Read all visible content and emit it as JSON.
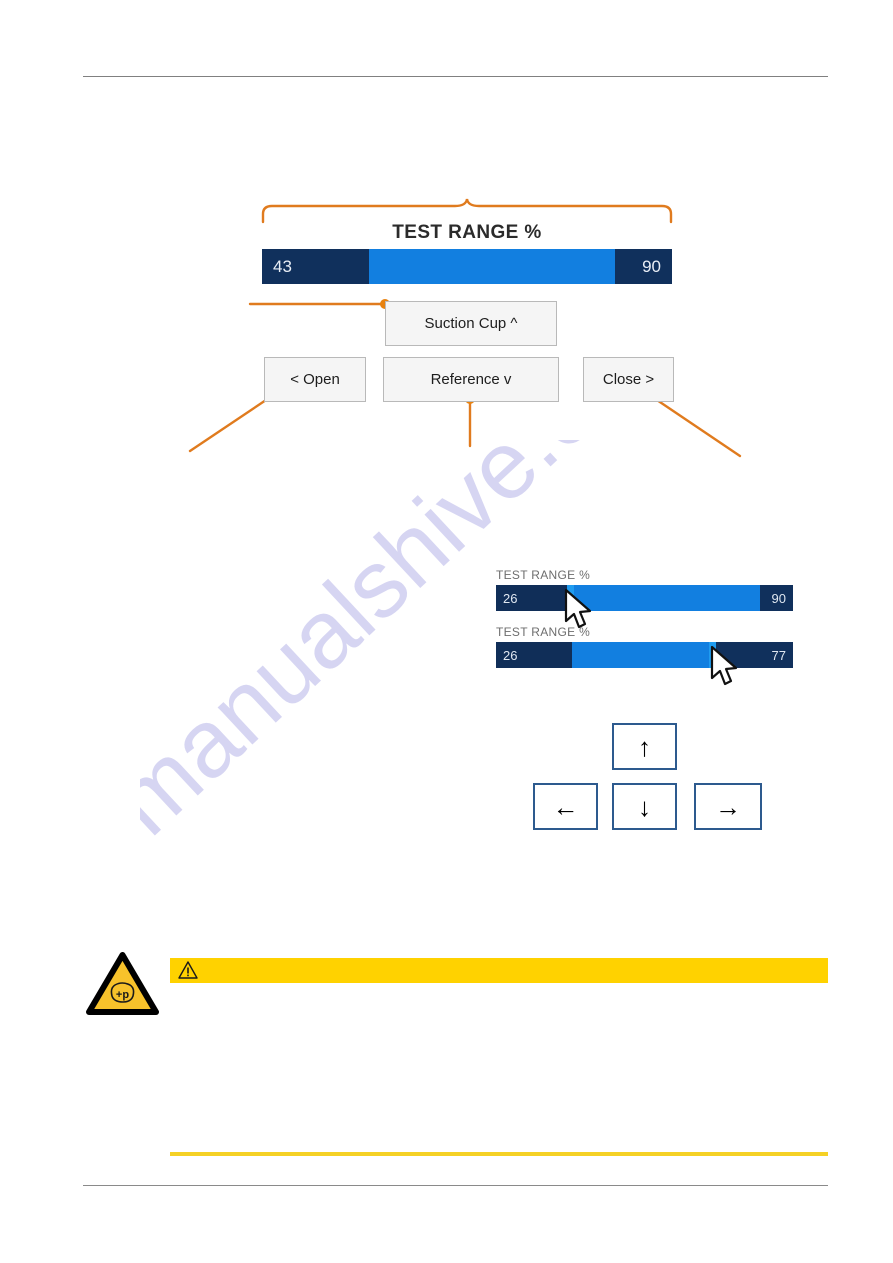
{
  "page": {
    "watermark_text": "manualshive.com",
    "colors": {
      "accent_orange": "#e07b1e",
      "bar_dark_navy": "#10305c",
      "bar_blue": "#127fe0",
      "bar_handle_blue": "#1f9cf0",
      "warning_yellow": "#ffd200",
      "rule_yellow": "#f5d125",
      "rule_gray": "#808080",
      "key_border_blue": "#2d5a8e"
    }
  },
  "main_slider": {
    "caption": "TEST RANGE %",
    "min_value": "43",
    "max_value": "90",
    "min_pct": 26,
    "max_pct": 88
  },
  "buttons": {
    "suction_cup": "Suction Cup ^",
    "open": "< Open",
    "reference": "Reference v",
    "close": "Close >"
  },
  "mini_sliders": [
    {
      "label": "TEST RANGE %",
      "min_value": "26",
      "max_value": "90",
      "min_pct": 24,
      "max_pct": 89,
      "cursor": "arrow-cursor-left-handle"
    },
    {
      "label": "TEST RANGE %",
      "min_value": "26",
      "max_value": "77",
      "min_pct": 24,
      "max_pct": 74,
      "cursor": "arrow-cursor-right-handle"
    }
  ],
  "arrow_keys": {
    "up": "↑",
    "left": "←",
    "down": "↓",
    "right": "→"
  },
  "warning": {
    "banner_text": "",
    "banner_icon": "warning-triangle-icon",
    "hazard_icon": "pressure-hazard-icon",
    "hazard_icon_label": "+p"
  },
  "annotations": {
    "brace": "curly-brace-over-test-range",
    "leaders": [
      "leader-suction-cup",
      "leader-open",
      "leader-reference",
      "leader-close"
    ]
  }
}
